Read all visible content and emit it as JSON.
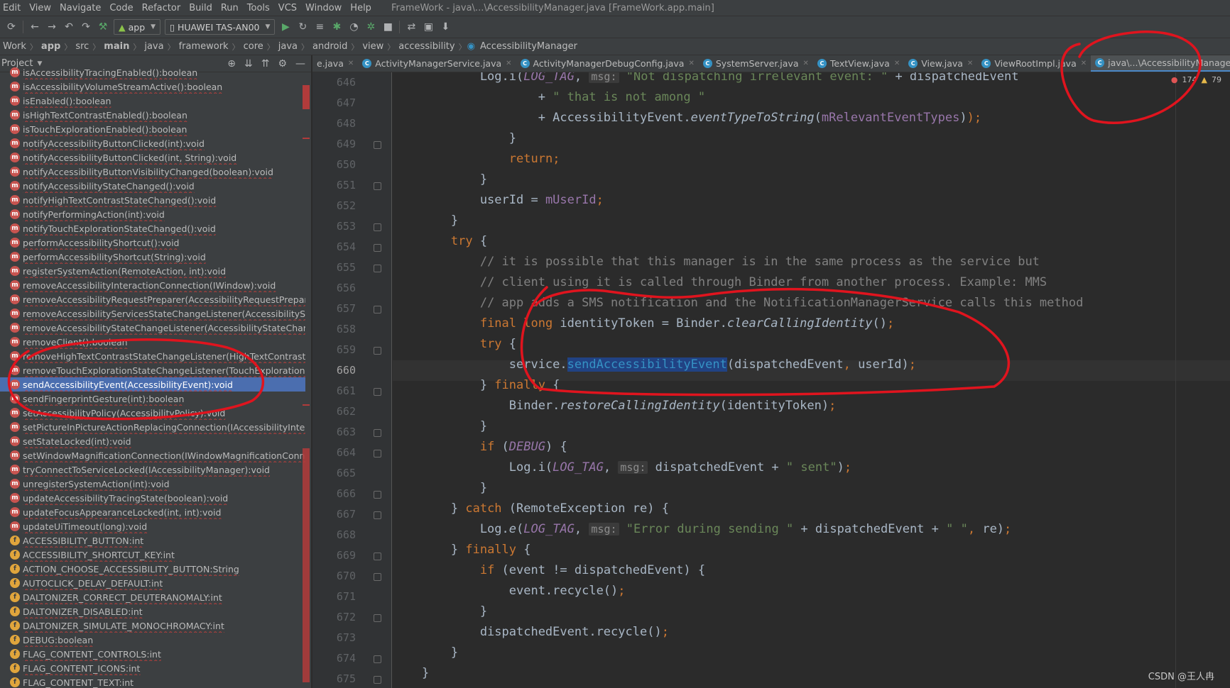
{
  "menu": [
    "Edit",
    "View",
    "Navigate",
    "Code",
    "Refactor",
    "Build",
    "Run",
    "Tools",
    "VCS",
    "Window",
    "Help"
  ],
  "window_title": "FrameWork - java\\...\\AccessibilityManager.java [FrameWork.app.main]",
  "toolbar": {
    "config": "app",
    "device": "HUAWEI TAS-AN00"
  },
  "breadcrumb": [
    "Work",
    "app",
    "src",
    "main",
    "java",
    "framework",
    "core",
    "java",
    "android",
    "view",
    "accessibility",
    "AccessibilityManager"
  ],
  "project_panel": {
    "title": "Project"
  },
  "tree_items": [
    {
      "label": "isAccessibilityTracingEnabled():boolean",
      "kind": "m"
    },
    {
      "label": "isAccessibilityVolumeStreamActive():boolean",
      "kind": "m"
    },
    {
      "label": "isEnabled():boolean",
      "kind": "m"
    },
    {
      "label": "isHighTextContrastEnabled():boolean",
      "kind": "m"
    },
    {
      "label": "isTouchExplorationEnabled():boolean",
      "kind": "m"
    },
    {
      "label": "notifyAccessibilityButtonClicked(int):void",
      "kind": "m"
    },
    {
      "label": "notifyAccessibilityButtonClicked(int, String):void",
      "kind": "m"
    },
    {
      "label": "notifyAccessibilityButtonVisibilityChanged(boolean):void",
      "kind": "m"
    },
    {
      "label": "notifyAccessibilityStateChanged():void",
      "kind": "m"
    },
    {
      "label": "notifyHighTextContrastStateChanged():void",
      "kind": "m"
    },
    {
      "label": "notifyPerformingAction(int):void",
      "kind": "m"
    },
    {
      "label": "notifyTouchExplorationStateChanged():void",
      "kind": "m"
    },
    {
      "label": "performAccessibilityShortcut():void",
      "kind": "m"
    },
    {
      "label": "performAccessibilityShortcut(String):void",
      "kind": "m"
    },
    {
      "label": "registerSystemAction(RemoteAction, int):void",
      "kind": "m"
    },
    {
      "label": "removeAccessibilityInteractionConnection(IWindow):void",
      "kind": "m"
    },
    {
      "label": "removeAccessibilityRequestPreparer(AccessibilityRequestPreparer):void",
      "kind": "m"
    },
    {
      "label": "removeAccessibilityServicesStateChangeListener(AccessibilityServicesSt",
      "kind": "m"
    },
    {
      "label": "removeAccessibilityStateChangeListener(AccessibilityStateChangeListener",
      "kind": "m"
    },
    {
      "label": "removeClient():boolean",
      "kind": "m"
    },
    {
      "label": "removeHighTextContrastStateChangeListener(HighTextContrastChange",
      "kind": "m"
    },
    {
      "label": "removeTouchExplorationStateChangeListener(TouchExplorationStateCl",
      "kind": "m"
    },
    {
      "label": "sendAccessibilityEvent(AccessibilityEvent):void",
      "kind": "m",
      "selected": true
    },
    {
      "label": "sendFingerprintGesture(int):boolean",
      "kind": "m"
    },
    {
      "label": "setAccessibilityPolicy(AccessibilityPolicy):void",
      "kind": "m"
    },
    {
      "label": "setPictureInPictureActionReplacingConnection(IAccessibilityInteractio",
      "kind": "m"
    },
    {
      "label": "setStateLocked(int):void",
      "kind": "m"
    },
    {
      "label": "setWindowMagnificationConnection(IWindowMagnificationConnecti",
      "kind": "m"
    },
    {
      "label": "tryConnectToServiceLocked(IAccessibilityManager):void",
      "kind": "m"
    },
    {
      "label": "unregisterSystemAction(int):void",
      "kind": "m"
    },
    {
      "label": "updateAccessibilityTracingState(boolean):void",
      "kind": "m"
    },
    {
      "label": "updateFocusAppearanceLocked(int, int):void",
      "kind": "m"
    },
    {
      "label": "updateUiTimeout(long):void",
      "kind": "m"
    },
    {
      "label": "ACCESSIBILITY_BUTTON:int",
      "kind": "f"
    },
    {
      "label": "ACCESSIBILITY_SHORTCUT_KEY:int",
      "kind": "f"
    },
    {
      "label": "ACTION_CHOOSE_ACCESSIBILITY_BUTTON:String",
      "kind": "f"
    },
    {
      "label": "AUTOCLICK_DELAY_DEFAULT:int",
      "kind": "f"
    },
    {
      "label": "DALTONIZER_CORRECT_DEUTERANOMALY:int",
      "kind": "f"
    },
    {
      "label": "DALTONIZER_DISABLED:int",
      "kind": "f"
    },
    {
      "label": "DALTONIZER_SIMULATE_MONOCHROMACY:int",
      "kind": "f"
    },
    {
      "label": "DEBUG:boolean",
      "kind": "f"
    },
    {
      "label": "FLAG_CONTENT_CONTROLS:int",
      "kind": "f"
    },
    {
      "label": "FLAG_CONTENT_ICONS:int",
      "kind": "f"
    },
    {
      "label": "FLAG_CONTENT_TEXT:int",
      "kind": "f"
    }
  ],
  "tabs": [
    {
      "label": "e.java"
    },
    {
      "label": "ActivityManagerService.java"
    },
    {
      "label": "ActivityManagerDebugConfig.java"
    },
    {
      "label": "SystemServer.java"
    },
    {
      "label": "TextView.java"
    },
    {
      "label": "View.java"
    },
    {
      "label": "ViewRootImpl.java"
    },
    {
      "label": "java\\...\\AccessibilityManager.java",
      "active": true
    }
  ],
  "problems": {
    "errors": "174",
    "warnings": "79"
  },
  "line_numbers": [
    "646",
    "647",
    "648",
    "649",
    "650",
    "651",
    "652",
    "653",
    "654",
    "655",
    "656",
    "657",
    "658",
    "659",
    "660",
    "661",
    "662",
    "663",
    "664",
    "665",
    "666",
    "667",
    "668",
    "669",
    "670",
    "671",
    "672",
    "673",
    "674",
    "675"
  ],
  "current_line": "660",
  "code_lines": [
    [
      [
        "            Log.i(",
        ""
      ],
      [
        "LOG_TAG",
        "fldi"
      ],
      [
        ", ",
        ""
      ],
      [
        "msg:",
        "hint"
      ],
      [
        " ",
        ""
      ],
      [
        "\"Not dispatching irrelevant event: \"",
        "str"
      ],
      [
        " + dispatchedEvent",
        ""
      ]
    ],
    [
      [
        "                    + ",
        ""
      ],
      [
        "\" that is not among \"",
        "str"
      ]
    ],
    [
      [
        "                    + AccessibilityEvent.",
        ""
      ],
      [
        "eventTypeToString",
        "ital"
      ],
      [
        "(",
        ""
      ],
      [
        "mRelevantEventTypes",
        "fld"
      ],
      [
        ")",
        ""
      ],
      [
        ");",
        "kw"
      ]
    ],
    [
      [
        "                }",
        ""
      ]
    ],
    [
      [
        "                ",
        ""
      ],
      [
        "return",
        "kw"
      ],
      [
        ";",
        "kw"
      ]
    ],
    [
      [
        "            }",
        ""
      ]
    ],
    [
      [
        "            userId = ",
        ""
      ],
      [
        "mUserId",
        "fld"
      ],
      [
        ";",
        "kw"
      ]
    ],
    [
      [
        "        }",
        ""
      ]
    ],
    [
      [
        "        ",
        ""
      ],
      [
        "try",
        "kw"
      ],
      [
        " {",
        ""
      ]
    ],
    [
      [
        "            ",
        ""
      ],
      [
        "// it is possible that this manager is in the same process as the service but",
        "cmt"
      ]
    ],
    [
      [
        "            ",
        ""
      ],
      [
        "// client using it is called through Binder from another process. Example: MMS",
        "cmt"
      ]
    ],
    [
      [
        "            ",
        ""
      ],
      [
        "// app adds a SMS notification and the NotificationManagerService calls this method",
        "cmt"
      ]
    ],
    [
      [
        "            ",
        ""
      ],
      [
        "final long",
        "kw"
      ],
      [
        " identityToken = Binder.",
        ""
      ],
      [
        "clearCallingIdentity",
        "ital"
      ],
      [
        "()",
        ""
      ],
      [
        ";",
        "kw"
      ]
    ],
    [
      [
        "            ",
        ""
      ],
      [
        "try",
        "kw"
      ],
      [
        " {",
        ""
      ]
    ],
    [
      [
        "                service.",
        ""
      ],
      [
        "sendAccessibilityEvent",
        "sel"
      ],
      [
        "(dispatchedEvent",
        ""
      ],
      [
        ", ",
        "kw"
      ],
      [
        "userId)",
        ""
      ],
      [
        ";",
        "kw"
      ]
    ],
    [
      [
        "            } ",
        ""
      ],
      [
        "finally",
        "kw"
      ],
      [
        " {",
        ""
      ]
    ],
    [
      [
        "                Binder.",
        ""
      ],
      [
        "restoreCallingIdentity",
        "ital"
      ],
      [
        "(identityToken)",
        ""
      ],
      [
        ";",
        "kw"
      ]
    ],
    [
      [
        "            }",
        ""
      ]
    ],
    [
      [
        "            ",
        ""
      ],
      [
        "if",
        "kw"
      ],
      [
        " (",
        ""
      ],
      [
        "DEBUG",
        "fldi"
      ],
      [
        ") {",
        ""
      ]
    ],
    [
      [
        "                Log.i(",
        ""
      ],
      [
        "LOG_TAG",
        "fldi"
      ],
      [
        ", ",
        ""
      ],
      [
        "msg:",
        "hint"
      ],
      [
        " dispatchedEvent + ",
        ""
      ],
      [
        "\" sent\"",
        "str"
      ],
      [
        ")",
        ""
      ],
      [
        ";",
        "kw"
      ]
    ],
    [
      [
        "            }",
        ""
      ]
    ],
    [
      [
        "        } ",
        ""
      ],
      [
        "catch",
        "kw"
      ],
      [
        " (RemoteException re) {",
        ""
      ]
    ],
    [
      [
        "            Log.",
        ""
      ],
      [
        "e",
        "ital"
      ],
      [
        "(",
        ""
      ],
      [
        "LOG_TAG",
        "fldi"
      ],
      [
        ", ",
        ""
      ],
      [
        "msg:",
        "hint"
      ],
      [
        " ",
        ""
      ],
      [
        "\"Error during sending \"",
        "str"
      ],
      [
        " + dispatchedEvent + ",
        ""
      ],
      [
        "\" \"",
        "str"
      ],
      [
        ", ",
        "kw"
      ],
      [
        "re)",
        ""
      ],
      [
        ";",
        "kw"
      ]
    ],
    [
      [
        "        } ",
        ""
      ],
      [
        "finally",
        "kw"
      ],
      [
        " {",
        ""
      ]
    ],
    [
      [
        "            ",
        ""
      ],
      [
        "if",
        "kw"
      ],
      [
        " (event != dispatchedEvent) {",
        ""
      ]
    ],
    [
      [
        "                event.recycle()",
        ""
      ],
      [
        ";",
        "kw"
      ]
    ],
    [
      [
        "            }",
        ""
      ]
    ],
    [
      [
        "            dispatchedEvent.recycle()",
        ""
      ],
      [
        ";",
        "kw"
      ]
    ],
    [
      [
        "        }",
        ""
      ]
    ],
    [
      [
        "    }",
        ""
      ]
    ]
  ],
  "watermark": "CSDN @王人冉",
  "colors": {
    "background": "#2b2b2b",
    "keyword": "#cc7832",
    "string": "#6a8759",
    "comment": "#808080",
    "field": "#9876aa",
    "selection": "#214283",
    "annotation": "#e0141e"
  }
}
